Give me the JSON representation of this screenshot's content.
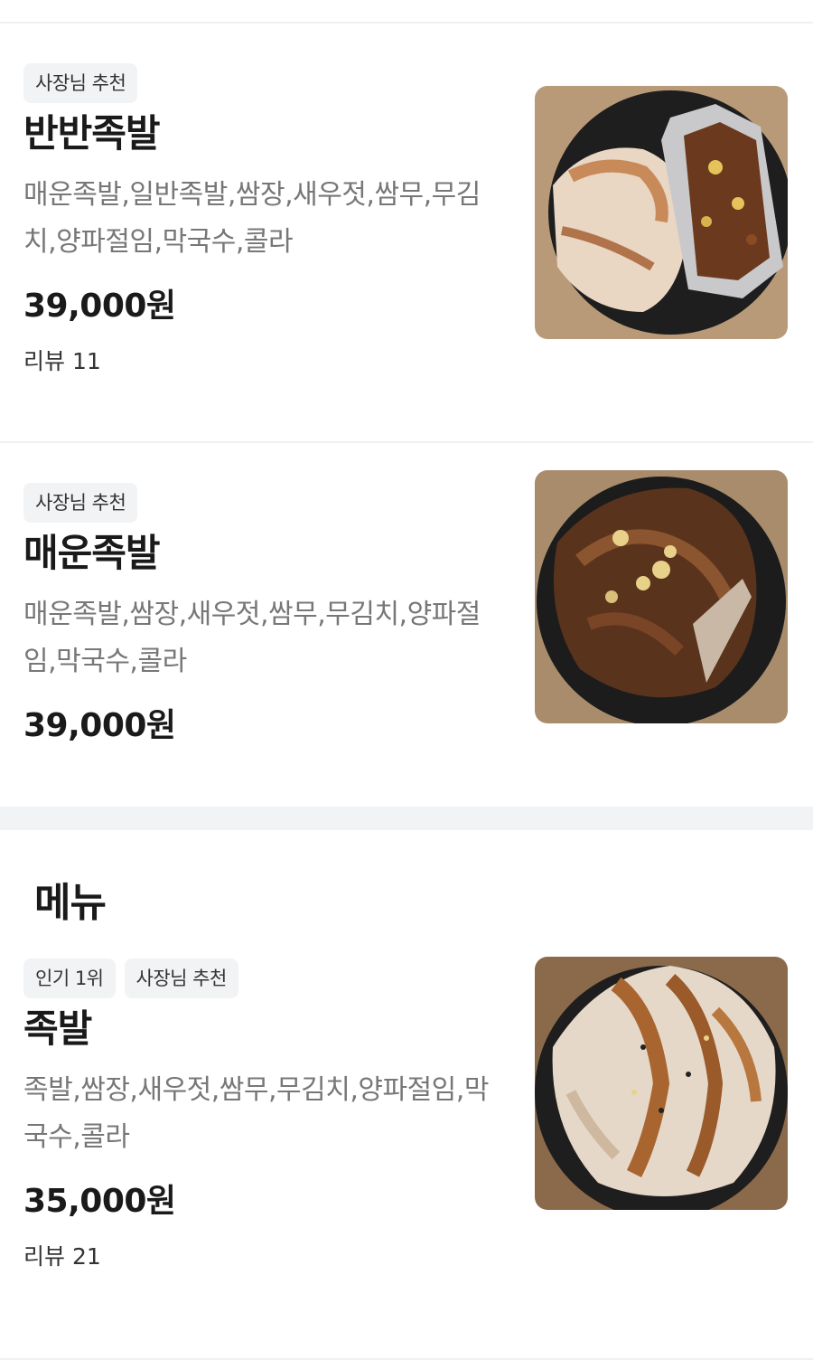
{
  "items_top": [
    {
      "tags": [
        "사장님 추천"
      ],
      "name": "반반족발",
      "desc": "매운족발,일반족발,쌈장,새우젓,쌈무,무김치,양파절임,막국수,콜라",
      "price": "39,000원",
      "review": "리뷰 11"
    },
    {
      "tags": [
        "사장님 추천"
      ],
      "name": "매운족발",
      "desc": "매운족발,쌈장,새우젓,쌈무,무김치,양파절임,막국수,콜라",
      "price": "39,000원",
      "review": ""
    }
  ],
  "section": {
    "title": "메뉴"
  },
  "item_menu": {
    "tags": [
      "인기 1위",
      "사장님 추천"
    ],
    "name": "족발",
    "desc": "족발,쌈장,새우젓,쌈무,무김치,양파절임,막국수,콜라",
    "price": "35,000원",
    "review": "리뷰 21"
  },
  "colors": {
    "tag_bg": "#f2f3f5",
    "desc": "#777777",
    "divider": "#eef0f2"
  }
}
